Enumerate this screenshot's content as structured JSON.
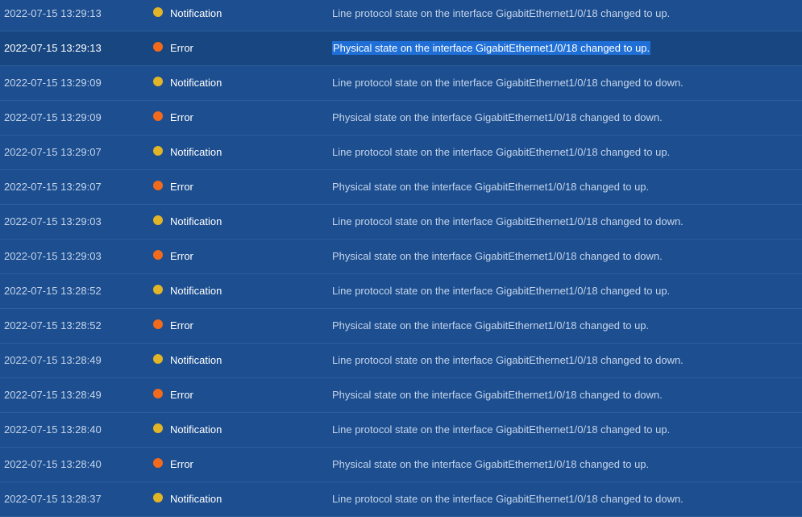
{
  "colors": {
    "notification": "#e2b427",
    "error": "#f26a1b"
  },
  "rows": [
    {
      "time": "2022-07-15 13:29:13",
      "level": "Notification",
      "icon": "yellow-dot-icon",
      "message": "Line protocol state on the interface GigabitEthernet1/0/18 changed to up.",
      "selected": false
    },
    {
      "time": "2022-07-15 13:29:13",
      "level": "Error",
      "icon": "orange-dot-icon",
      "message": "Physical state on the interface GigabitEthernet1/0/18 changed to up.",
      "selected": true
    },
    {
      "time": "2022-07-15 13:29:09",
      "level": "Notification",
      "icon": "yellow-dot-icon",
      "message": "Line protocol state on the interface GigabitEthernet1/0/18 changed to down.",
      "selected": false
    },
    {
      "time": "2022-07-15 13:29:09",
      "level": "Error",
      "icon": "orange-dot-icon",
      "message": "Physical state on the interface GigabitEthernet1/0/18 changed to down.",
      "selected": false
    },
    {
      "time": "2022-07-15 13:29:07",
      "level": "Notification",
      "icon": "yellow-dot-icon",
      "message": "Line protocol state on the interface GigabitEthernet1/0/18 changed to up.",
      "selected": false
    },
    {
      "time": "2022-07-15 13:29:07",
      "level": "Error",
      "icon": "orange-dot-icon",
      "message": "Physical state on the interface GigabitEthernet1/0/18 changed to up.",
      "selected": false
    },
    {
      "time": "2022-07-15 13:29:03",
      "level": "Notification",
      "icon": "yellow-dot-icon",
      "message": "Line protocol state on the interface GigabitEthernet1/0/18 changed to down.",
      "selected": false
    },
    {
      "time": "2022-07-15 13:29:03",
      "level": "Error",
      "icon": "orange-dot-icon",
      "message": "Physical state on the interface GigabitEthernet1/0/18 changed to down.",
      "selected": false
    },
    {
      "time": "2022-07-15 13:28:52",
      "level": "Notification",
      "icon": "yellow-dot-icon",
      "message": "Line protocol state on the interface GigabitEthernet1/0/18 changed to up.",
      "selected": false
    },
    {
      "time": "2022-07-15 13:28:52",
      "level": "Error",
      "icon": "orange-dot-icon",
      "message": "Physical state on the interface GigabitEthernet1/0/18 changed to up.",
      "selected": false
    },
    {
      "time": "2022-07-15 13:28:49",
      "level": "Notification",
      "icon": "yellow-dot-icon",
      "message": "Line protocol state on the interface GigabitEthernet1/0/18 changed to down.",
      "selected": false
    },
    {
      "time": "2022-07-15 13:28:49",
      "level": "Error",
      "icon": "orange-dot-icon",
      "message": "Physical state on the interface GigabitEthernet1/0/18 changed to down.",
      "selected": false
    },
    {
      "time": "2022-07-15 13:28:40",
      "level": "Notification",
      "icon": "yellow-dot-icon",
      "message": "Line protocol state on the interface GigabitEthernet1/0/18 changed to up.",
      "selected": false
    },
    {
      "time": "2022-07-15 13:28:40",
      "level": "Error",
      "icon": "orange-dot-icon",
      "message": "Physical state on the interface GigabitEthernet1/0/18 changed to up.",
      "selected": false
    },
    {
      "time": "2022-07-15 13:28:37",
      "level": "Notification",
      "icon": "yellow-dot-icon",
      "message": "Line protocol state on the interface GigabitEthernet1/0/18 changed to down.",
      "selected": false
    }
  ]
}
